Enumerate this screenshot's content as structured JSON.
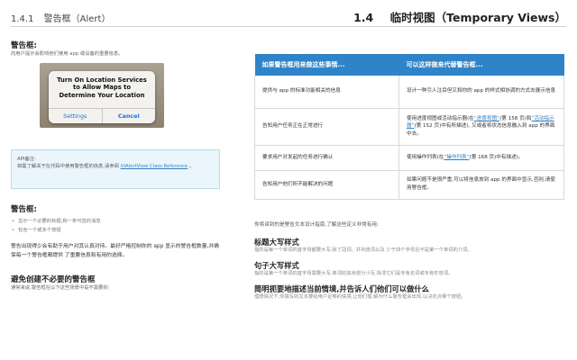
{
  "header": {
    "left_number": "1.4.1",
    "left_title": "警告框（Alert）",
    "right_number": "1.4",
    "right_title": "临时视图（Temporary Views）"
  },
  "left": {
    "intro_heading": "警告框:",
    "intro_text": "向用户提示会影响他们使用 app 或设备的重要信息。",
    "alert": {
      "title": "Turn On Location Services to Allow Maps to Determine Your Location",
      "left_button": "Settings",
      "right_button": "Cancel"
    },
    "api_note": {
      "label": "API备注:",
      "text": "如需了解关于在代码中使用警告框的信息,请参阅",
      "link": "UIAlertView Class Reference",
      "suffix": "。"
    },
    "features_heading": "警告框:",
    "features": [
      "显示一个必要的标题,和一条可选的消息",
      "包含一个或多个按钮"
    ],
    "paragraph": "警告出现得少会有助于用户对其认真对待。最好严格控制你的 app 显示的警告框数量,并确保每一个警告框都提供 了重要信息和有用的选择。",
    "avoid_heading": "避免创建不必要的警告框",
    "avoid_text": "通常来说,警告框在以下这些场景中是不需要的:"
  },
  "table": {
    "headers": [
      "如果警告框用来做这些事情...",
      "可以这样做来代替警告框..."
    ],
    "rows": [
      {
        "left": "提供与 app 的标准功能相关的信息",
        "right_parts": [
          {
            "t": "设计一种引人注目但又和你的 app 的样式相协调的方式去展示信息"
          }
        ]
      },
      {
        "left": "告知用户任务正在正常进行",
        "right_parts": [
          {
            "t": "使用进度视图或活动指示器(在"
          },
          {
            "t": "“进度视图”",
            "link": true
          },
          {
            "t": "(第 158 页)和"
          },
          {
            "t": "“活动指示器”",
            "link": true
          },
          {
            "t": "(第 152 页)中有所描述), 又或者将状态信息融入到 app 的界面中去。"
          }
        ]
      },
      {
        "left": "要求用户对发起的任务进行确认",
        "right_parts": [
          {
            "t": "使用操作列表(在"
          },
          {
            "t": "“操作列表”",
            "link": true
          },
          {
            "t": "(第 168 页)中有描述)。"
          }
        ]
      },
      {
        "left": "告知用户他们所不能解决的问题",
        "right_parts": [
          {
            "t": "如果问题不是很严重,可以将信息放到 app 的界面中显示,否则,请使用警告框。"
          }
        ]
      }
    ]
  },
  "right": {
    "note": "你将读到的是警告文本设计指南,了解这些定义非常有用:",
    "sections": [
      {
        "heading": "标题大写样式",
        "text": "指的是每一个单词的首字母都要大写,除了冠词、并列连词以及 少于四个字母且不是第一个单词的介词。"
      },
      {
        "heading": "句子大写样式",
        "text": "指的是第一个单词的首字母需要大写,单词的其余部分小写,除非它们是专有名词或专有形容词。"
      },
      {
        "heading": "简明扼要地描述当前情境,并告诉人们他们可以做什么",
        "text": "理想情况下,你撰写的文本要给用户足够的情境,让他们理 解为什么警告框会出现,以决定点哪个按钮。"
      }
    ]
  }
}
